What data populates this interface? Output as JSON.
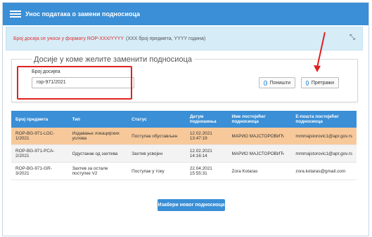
{
  "header": {
    "title": "Унос података о замени подносиоца",
    "menu_icon": "hamburger-icon"
  },
  "info": {
    "text_red": "Број досија се уноси у формату ROP-XXX/YYYY",
    "text_gray": "(XXX број предмета, YYYY година)",
    "collapse_icon": "collapse-arrows-icon"
  },
  "form": {
    "legend": "Досије у коме желите заменити подносиоца",
    "field_label": "Број досијеа",
    "field_value": "rop-971/2021",
    "clear_label": "Поништи",
    "search_label": "Претражи"
  },
  "table": {
    "headers": [
      "Број предмета",
      "Тип",
      "Статус",
      "Датум подношења",
      "Име постојећег подносиоца",
      "Е-пошта постојећег подносиоца"
    ],
    "rows": [
      [
        "ROP-BG-971-LOC-1/2021",
        "Издавање локацијских услова",
        "Поступак обустављен",
        "12.02.2021 13:47:19",
        "МАРИО МАЈСТОРОВИЋ",
        "mmmajstorovic1@apr.gov.rs"
      ],
      [
        "ROP-BG-971-PCA-2/2021",
        "Одустанак од захтева",
        "Захтев усвојен",
        "12.02.2021 14:16:14",
        "МАРИО МАЈСТОРОВИЋ",
        "mmmajstorovic1@apr.gov.rs"
      ],
      [
        "ROP-BG-971-GR-3/2021",
        "Захтев за остале поступке V2",
        "Поступак у току",
        "22.04.2021 15:55:31",
        "Zora Kotaras",
        "zora.kotaras@gmail.com"
      ]
    ]
  },
  "actions": {
    "choose_label": "Изабери новог подносиоца"
  },
  "colors": {
    "accent": "#3a8fd6",
    "highlight": "#f7c99a",
    "annotation": "#e02020"
  }
}
